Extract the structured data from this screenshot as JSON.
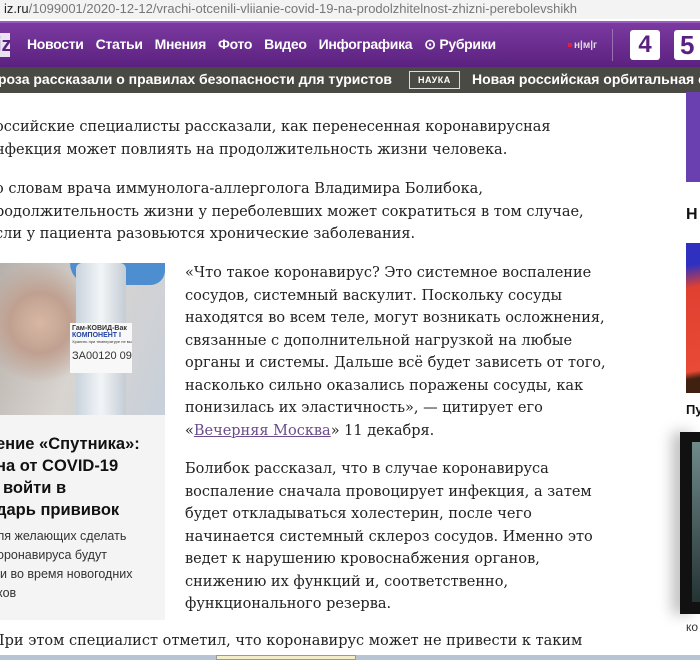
{
  "browser": {
    "url_domain": "iz.ru",
    "url_path": "/1099001/2020-12-12/vrachi-otcenili-vliianie-covid-19-na-prodolzhitelnost-zhizni-perebolevshikh"
  },
  "nav": {
    "logo": "iz",
    "items": [
      "Новости",
      "Статьи",
      "Мнения",
      "Фото",
      "Видео",
      "Инфографика",
      "Рубрики"
    ],
    "nmg": "н|м|г",
    "channel4": "4",
    "channel5": "5"
  },
  "ticker": {
    "item1": "роза рассказали о правилах безопасности для туристов",
    "tag": "НАУКА",
    "item2": "Новая российская орбитальная с"
  },
  "article": {
    "p1": [
      "оссийские специалисты рассказали, как перенесенная коронавирусная",
      "нфекция может повлиять на продолжительность жизни человека."
    ],
    "p2": [
      "о словам врача иммунолога-аллерголога Владимира Болибока,",
      "родолжительность жизни у переболевших может сократиться в том случае,",
      "сли у пациента разовьются хронические заболевания."
    ],
    "p3": [
      "«Что такое коронавирус? Это системное воспаление",
      "сосудов, системный васкулит. Поскольку сосуды",
      "находятся во всем теле, могут возникать осложнения,",
      "связанные с дополнительной нагрузкой на любые",
      "органы и системы. Дальше всё будет зависеть от того,",
      "насколько сильно оказались поражены сосуды, как",
      "понизилась их эластичность», — цитирует его"
    ],
    "p3_open": "«",
    "p3_link": "Вечерняя Москва",
    "p3_end": "» 11 декабря.",
    "p4": [
      "Болибок рассказал, что в случае коронавируса",
      "воспаление сначала провоцирует инфекция, а затем",
      "будет откладываться холестерин, после чего",
      "начинается системный склероз сосудов. Именно это",
      "ведет к нарушению кровоснабжения органов,",
      "снижению их функций и, соответственно,",
      "функционального резерва."
    ],
    "p5": "При этом специалист отметил, что коронавирус может не привести к таким"
  },
  "card": {
    "vial_name": "Гам-КОВИД-Вак",
    "vial_component": "КОМПОНЕНТ I",
    "vial_note": "Хранить при температуре не выше минус 18 °C",
    "vial_number": "ЗА00120  09",
    "title": [
      "ение «Спутника»:",
      "на от COVID-19",
      "войти в",
      "дарь прививок"
    ],
    "sub": [
      "ля желающих сделать",
      "оронавируса будут",
      "и во время новогодних",
      "ков"
    ]
  },
  "right": {
    "heading": "Н",
    "caption": "Пу",
    "video_caption": "ко"
  }
}
